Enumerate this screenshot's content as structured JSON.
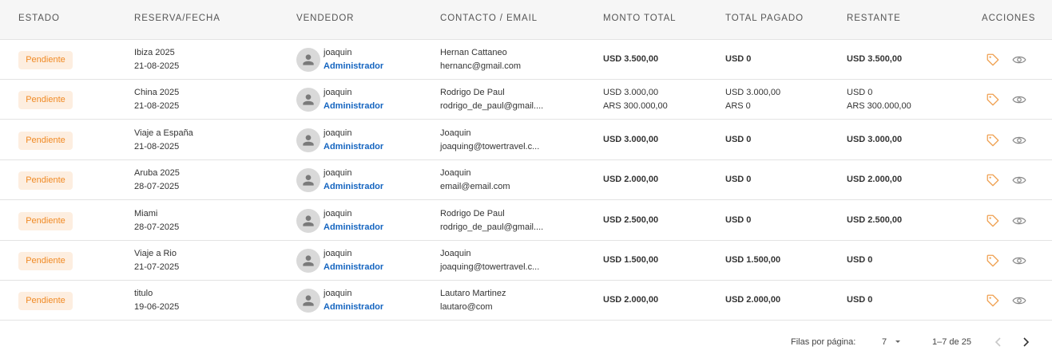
{
  "table": {
    "columns": {
      "estado": "ESTADO",
      "reserva": "RESERVA/FECHA",
      "vendedor": "VENDEDOR",
      "contacto": "CONTACTO / EMAIL",
      "monto": "MONTO TOTAL",
      "pagado": "TOTAL PAGADO",
      "restante": "RESTANTE",
      "acciones": "ACCIONES"
    },
    "rows": [
      {
        "estado": "Pendiente",
        "reserva": "Ibiza 2025",
        "fecha": "21-08-2025",
        "vendedor": "joaquin",
        "rol": "Administrador",
        "contacto": "Hernan Cattaneo",
        "email": "hernanc@gmail.com",
        "monto": [
          "USD 3.500,00"
        ],
        "pagado": [
          "USD 0"
        ],
        "restante": [
          "USD 3.500,00"
        ]
      },
      {
        "estado": "Pendiente",
        "reserva": "China 2025",
        "fecha": "21-08-2025",
        "vendedor": "joaquin",
        "rol": "Administrador",
        "contacto": "Rodrigo De Paul",
        "email": "rodrigo_de_paul@gmail....",
        "monto": [
          "USD 3.000,00",
          "ARS 300.000,00"
        ],
        "pagado": [
          "USD 3.000,00",
          "ARS 0"
        ],
        "restante": [
          "USD 0",
          "ARS 300.000,00"
        ]
      },
      {
        "estado": "Pendiente",
        "reserva": "Viaje a España",
        "fecha": "21-08-2025",
        "vendedor": "joaquin",
        "rol": "Administrador",
        "contacto": "Joaquin",
        "email": "joaquing@towertravel.c...",
        "monto": [
          "USD 3.000,00"
        ],
        "pagado": [
          "USD 0"
        ],
        "restante": [
          "USD 3.000,00"
        ]
      },
      {
        "estado": "Pendiente",
        "reserva": "Aruba 2025",
        "fecha": "28-07-2025",
        "vendedor": "joaquin",
        "rol": "Administrador",
        "contacto": "Joaquin",
        "email": "email@email.com",
        "monto": [
          "USD 2.000,00"
        ],
        "pagado": [
          "USD 0"
        ],
        "restante": [
          "USD 2.000,00"
        ]
      },
      {
        "estado": "Pendiente",
        "reserva": "Miami",
        "fecha": "28-07-2025",
        "vendedor": "joaquin",
        "rol": "Administrador",
        "contacto": "Rodrigo De Paul",
        "email": "rodrigo_de_paul@gmail....",
        "monto": [
          "USD 2.500,00"
        ],
        "pagado": [
          "USD 0"
        ],
        "restante": [
          "USD 2.500,00"
        ]
      },
      {
        "estado": "Pendiente",
        "reserva": "Viaje a Rio",
        "fecha": "21-07-2025",
        "vendedor": "joaquin",
        "rol": "Administrador",
        "contacto": "Joaquin",
        "email": "joaquing@towertravel.c...",
        "monto": [
          "USD 1.500,00"
        ],
        "pagado": [
          "USD 1.500,00"
        ],
        "restante": [
          "USD 0"
        ]
      },
      {
        "estado": "Pendiente",
        "reserva": "titulo",
        "fecha": "19-06-2025",
        "vendedor": "joaquin",
        "rol": "Administrador",
        "contacto": "Lautaro Martinez",
        "email": "lautaro@com",
        "monto": [
          "USD 2.000,00"
        ],
        "pagado": [
          "USD 2.000,00"
        ],
        "restante": [
          "USD 0"
        ]
      }
    ]
  },
  "pagination": {
    "rows_per_page_label": "Filas por página:",
    "rows_per_page_value": "7",
    "range_label": "1–7 de 25"
  },
  "icons": {
    "action_price": "tag-icon",
    "action_view": "eye-icon",
    "avatar": "person-icon",
    "dropdown": "caret-down-icon",
    "prev": "chevron-left-icon",
    "next": "chevron-right-icon"
  },
  "colors": {
    "badge_bg": "#fdeee0",
    "badge_text": "#f08a24",
    "role_text": "#1565c0",
    "tag_icon": "#f0a050",
    "eye_icon": "#888888",
    "header_bg": "#f6f6f6"
  }
}
